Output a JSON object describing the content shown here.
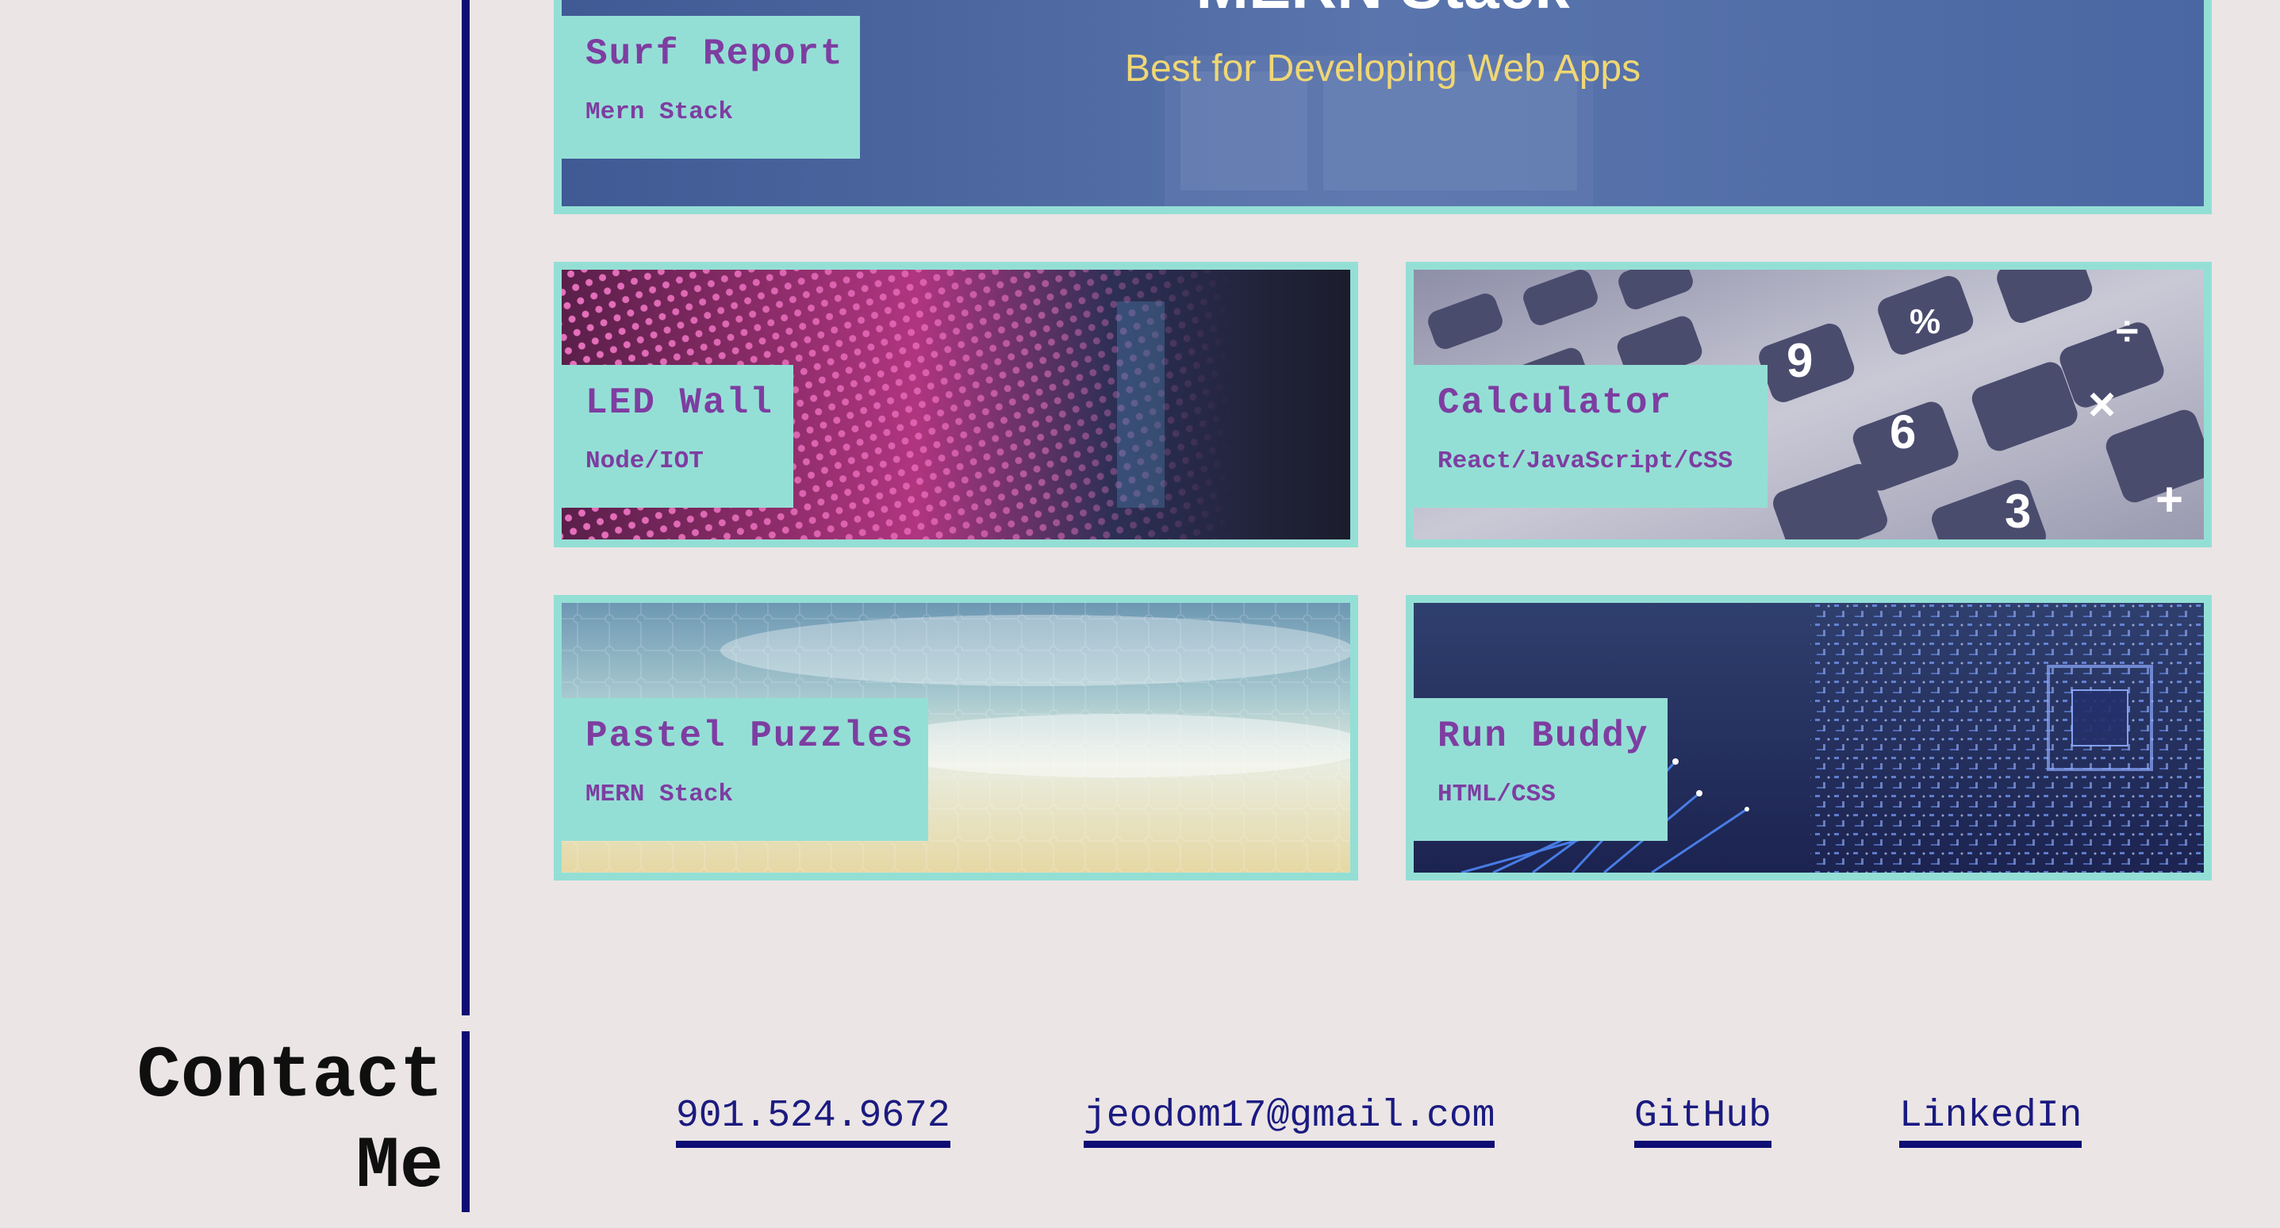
{
  "projects": [
    {
      "title": "Surf Report",
      "subtitle": "Mern Stack",
      "banner_title": "MERN Stack",
      "banner_tagline": "Best for Developing Web Apps"
    },
    {
      "title": "LED Wall",
      "subtitle": "Node/IOT"
    },
    {
      "title": "Calculator",
      "subtitle": "React/JavaScript/CSS"
    },
    {
      "title": "Pastel Puzzles",
      "subtitle": "MERN Stack"
    },
    {
      "title": "Run Buddy",
      "subtitle": "HTML/CSS"
    }
  ],
  "contact": {
    "heading_line1": "Contact",
    "heading_line2": "Me",
    "links": [
      {
        "label": "901.524.9672"
      },
      {
        "label": "jeodom17@gmail.com"
      },
      {
        "label": "GitHub"
      },
      {
        "label": "LinkedIn"
      }
    ]
  },
  "colors": {
    "background": "#ebe5e5",
    "accent_line": "#0d0d73",
    "card_border": "#94dfd5",
    "label_text": "#7e3da1"
  }
}
